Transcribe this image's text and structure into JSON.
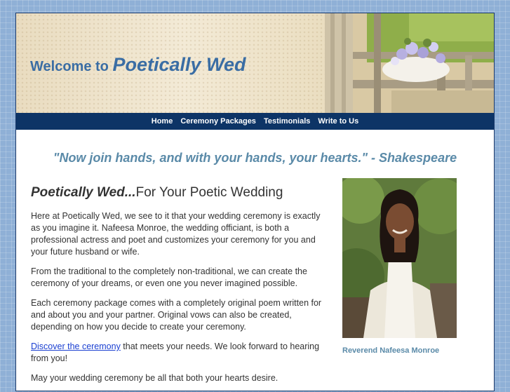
{
  "header": {
    "welcome_prefix": "Welcome to",
    "site_name": "Poetically Wed"
  },
  "nav": {
    "items": [
      {
        "label": "Home"
      },
      {
        "label": "Ceremony Packages"
      },
      {
        "label": "Testimonials"
      },
      {
        "label": "Write to Us"
      }
    ]
  },
  "quote": "\"Now join hands, and with your hands, your hearts.\" - Shakespeare",
  "main": {
    "heading_em": "Poetically Wed...",
    "heading_rest": "For Your Poetic Wedding",
    "paragraphs": [
      "Here at Poetically Wed, we see to it that your wedding ceremony is exactly as you imagine it.  Nafeesa Monroe, the wedding officiant, is both a professional actress and poet and customizes your ceremony for you and your future husband or wife.",
      "From the traditional to the completely non-traditional, we can create the ceremony of your dreams, or even one you never imagined possible.",
      "Each ceremony package comes with a completely original poem written for and about you and your partner.  Original vows can also be created, depending on how you decide to create your ceremony."
    ],
    "link_text": "Discover the ceremony",
    "link_rest": " that meets your needs.  We look forward to hearing from you!",
    "closing": "May your wedding ceremony be all that both your hearts desire."
  },
  "portrait": {
    "caption": "Reverend Nafeesa Monroe"
  },
  "colors": {
    "nav_bg": "#0d3466",
    "accent_blue": "#3a6da4",
    "quote_color": "#5a8aa8",
    "page_bg": "#8fb0d6"
  }
}
